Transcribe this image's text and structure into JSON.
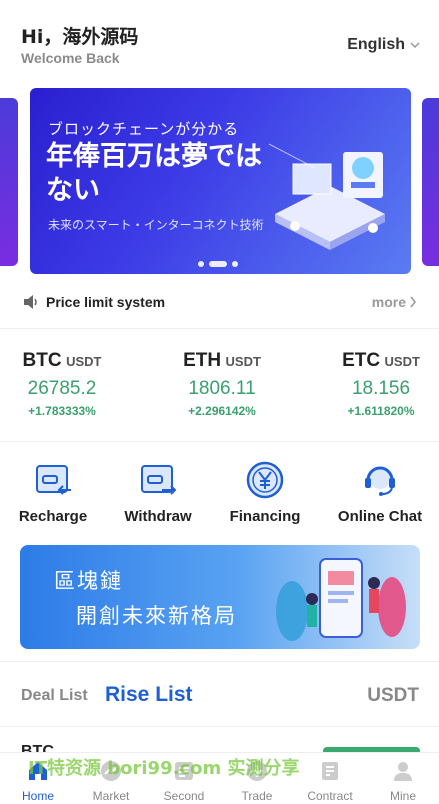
{
  "header": {
    "greeting": "Hi，海外源码",
    "subtitle": "Welcome Back",
    "language": "English"
  },
  "banner": {
    "line1": "ブロックチェーンが分かる",
    "line2": "年俸百万は夢ではない",
    "line3": "未来のスマート・インターコネクト技術",
    "slides": 3,
    "active_slide": 2
  },
  "notice": {
    "text": "Price limit system",
    "more": "more"
  },
  "tickers": [
    {
      "name": "BTC",
      "quote": "USDT",
      "price": "26785.2",
      "change": "+1.783333%"
    },
    {
      "name": "ETH",
      "quote": "USDT",
      "price": "1806.11",
      "change": "+2.296142%"
    },
    {
      "name": "ETC",
      "quote": "USDT",
      "price": "18.156",
      "change": "+1.611820%"
    }
  ],
  "actions": [
    {
      "label": "Recharge",
      "icon": "recharge-icon"
    },
    {
      "label": "Withdraw",
      "icon": "withdraw-icon"
    },
    {
      "label": "Financing",
      "icon": "yen-coin-icon"
    },
    {
      "label": "Online Chat",
      "icon": "headset-icon"
    }
  ],
  "promo": {
    "line1": "區塊鏈",
    "line2": "開創未來新格局"
  },
  "deal_tabs": {
    "deal_list": "Deal List",
    "rise_list": "Rise List",
    "quote": "USDT"
  },
  "list_peek": {
    "first_symbol": "BTC"
  },
  "watermark": "IT特资源  bori99.com  实测分享",
  "bottom_nav": [
    {
      "label": "Home",
      "icon": "home-icon",
      "active": true
    },
    {
      "label": "Market",
      "icon": "market-icon",
      "active": false
    },
    {
      "label": "Second",
      "icon": "second-icon",
      "active": false
    },
    {
      "label": "Trade",
      "icon": "trade-icon",
      "active": false
    },
    {
      "label": "Contract",
      "icon": "contract-icon",
      "active": false
    },
    {
      "label": "Mine",
      "icon": "user-icon",
      "active": false
    }
  ],
  "colors": {
    "accent": "#1f5fd6",
    "up": "#3aa06e",
    "banner": "#3c3ae6"
  }
}
